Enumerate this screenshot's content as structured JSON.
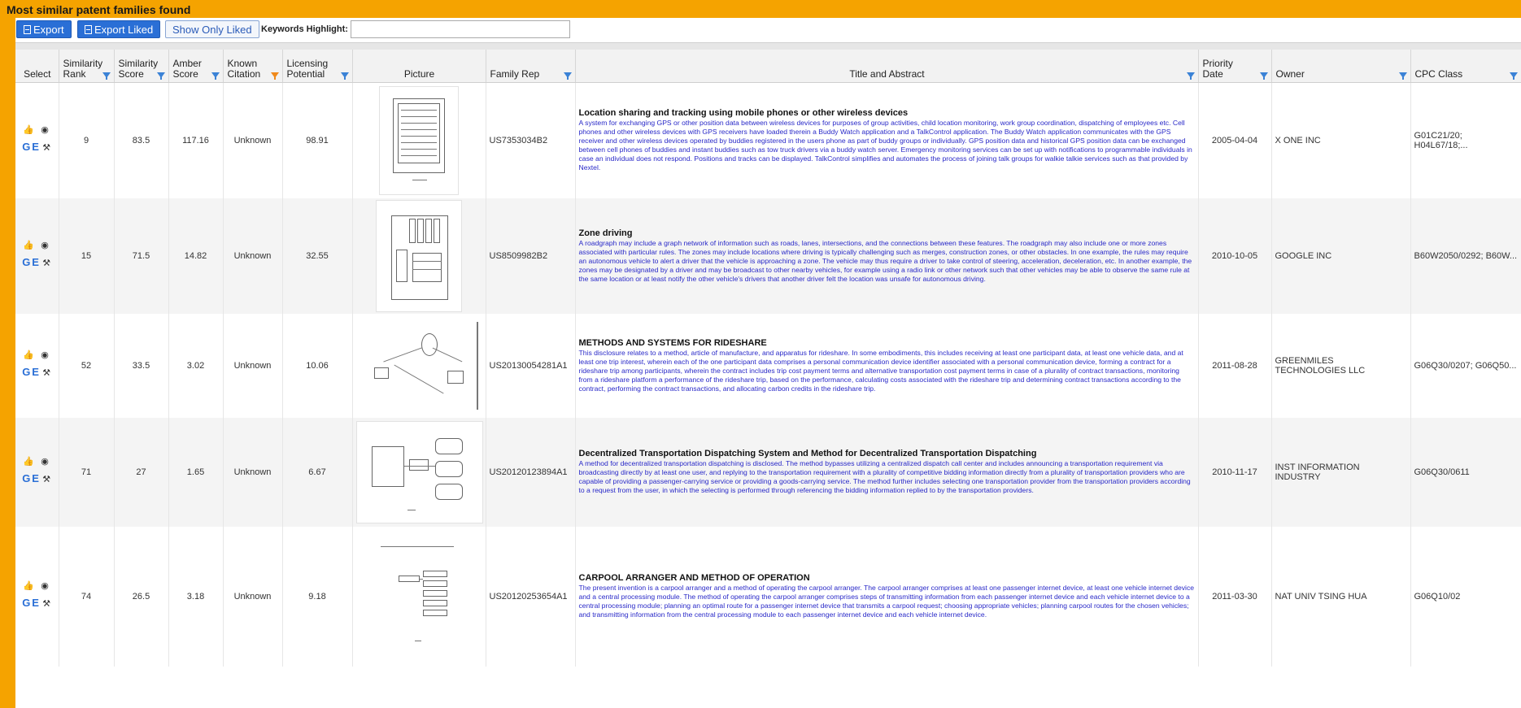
{
  "header": {
    "title": "Most similar patent families found"
  },
  "toolbar": {
    "export_label": "Export",
    "export_liked_label": "Export Liked",
    "show_liked_label": "Show Only Liked",
    "keywords_label": "Keywords Highlight:",
    "keywords_value": ""
  },
  "columns": {
    "select": "Select",
    "similarity_rank": [
      "Similarity",
      "Rank"
    ],
    "similarity_score": [
      "Similarity",
      "Score"
    ],
    "amber_score": [
      "Amber",
      "Score"
    ],
    "known_citation": [
      "Known",
      "Citation"
    ],
    "licensing_potential": [
      "Licensing",
      "Potential"
    ],
    "picture": "Picture",
    "family_rep": "Family Rep",
    "title_abstract": "Title and Abstract",
    "priority_date": [
      "Priority",
      "Date"
    ],
    "owner": "Owner",
    "cpc_class": "CPC Class"
  },
  "icons": {
    "like": "thumbs-up-icon",
    "hide": "eye-slash-icon",
    "google": "G",
    "espacenet": "E",
    "tools": "tools-icon"
  },
  "colors": {
    "accent": "#f5a300",
    "button": "#2a6fd6",
    "abstract_text": "#2929c8",
    "filter_icon": "#3b82d6",
    "filter_active": "#f08a1c"
  },
  "rows": [
    {
      "rank": "9",
      "sim_score": "83.5",
      "amber": "117.16",
      "citation": "Unknown",
      "licensing": "98.91",
      "family_rep": "US7353034B2",
      "title": "Location sharing and tracking using mobile phones or other wireless devices",
      "abstract": "A system for exchanging GPS or other position data between wireless devices for purposes of group activities, child location monitoring, work group coordination, dispatching of employees etc. Cell phones and other wireless devices with GPS receivers have loaded therein a Buddy Watch application and a TalkControl application. The Buddy Watch application communicates with the GPS receiver and other wireless devices operated by buddies registered in the users phone as part of buddy groups or individually. GPS position data and historical GPS position data can be exchanged between cell phones of buddies and instant buddies such as tow truck drivers via a buddy watch server. Emergency monitoring services can be set up with notifications to programmable individuals in case an individual does not respond. Positions and tracks can be displayed. TalkControl simplifies and automates the process of joining talk groups for walkie talkie services such as that provided by Nextel.",
      "priority_date": "2005-04-04",
      "owner": "X ONE INC",
      "cpc": "G01C21/20; H04L67/18;..."
    },
    {
      "rank": "15",
      "sim_score": "71.5",
      "amber": "14.82",
      "citation": "Unknown",
      "licensing": "32.55",
      "family_rep": "US8509982B2",
      "title": "Zone driving",
      "abstract": "A roadgraph may include a graph network of information such as roads, lanes, intersections, and the connections between these features. The roadgraph may also include one or more zones associated with particular rules. The zones may include locations where driving is typically challenging such as merges, construction zones, or other obstacles. In one example, the rules may require an autonomous vehicle to alert a driver that the vehicle is approaching a zone. The vehicle may thus require a driver to take control of steering, acceleration, deceleration, etc. In another example, the zones may be designated by a driver and may be broadcast to other nearby vehicles, for example using a radio link or other network such that other vehicles may be able to observe the same rule at the same location or at least notify the other vehicle's drivers that another driver felt the location was unsafe for autonomous driving.",
      "priority_date": "2010-10-05",
      "owner": "GOOGLE INC",
      "cpc": "B60W2050/0292; B60W..."
    },
    {
      "rank": "52",
      "sim_score": "33.5",
      "amber": "3.02",
      "citation": "Unknown",
      "licensing": "10.06",
      "family_rep": "US20130054281A1",
      "title": "METHODS AND SYSTEMS FOR RIDESHARE",
      "abstract": "This disclosure relates to a method, article of manufacture, and apparatus for rideshare. In some embodiments, this includes receiving at least one participant data, at least one vehicle data, and at least one trip interest, wherein each of the one participant data comprises a personal communication device identifier associated with a personal communication device, forming a contract for a rideshare trip among participants, wherein the contract includes trip cost payment terms and alternative transportation cost payment terms in case of a plurality of contract transactions, monitoring from a rideshare platform a performance of the rideshare trip, based on the performance, calculating costs associated with the rideshare trip and determining contract transactions according to the contract, performing the contract transactions, and allocating carbon credits in the rideshare trip.",
      "priority_date": "2011-08-28",
      "owner": "GREENMILES TECHNOLOGIES LLC",
      "cpc": "G06Q30/0207; G06Q50..."
    },
    {
      "rank": "71",
      "sim_score": "27",
      "amber": "1.65",
      "citation": "Unknown",
      "licensing": "6.67",
      "family_rep": "US20120123894A1",
      "title": "Decentralized Transportation Dispatching System and Method for Decentralized Transportation Dispatching",
      "abstract": "A method for decentralized transportation dispatching is disclosed. The method bypasses utilizing a centralized dispatch call center and includes announcing a transportation requirement via broadcasting directly by at least one user, and replying to the transportation requirement with a plurality of competitive bidding information directly from a plurality of transportation providers who are capable of providing a passenger-carrying service or providing a goods-carrying service. The method further includes selecting one transportation provider from the transportation providers according to a request from the user, in which the selecting is performed through referencing the bidding information replied to by the transportation providers.",
      "priority_date": "2010-11-17",
      "owner": "INST INFORMATION INDUSTRY",
      "cpc": "G06Q30/0611"
    },
    {
      "rank": "74",
      "sim_score": "26.5",
      "amber": "3.18",
      "citation": "Unknown",
      "licensing": "9.18",
      "family_rep": "US20120253654A1",
      "title": "CARPOOL ARRANGER AND METHOD OF OPERATION",
      "abstract": "The present invention is a carpool arranger and a method of operating the carpool arranger. The carpool arranger comprises at least one passenger internet device, at least one vehicle internet device and a central processing module. The method of operating the carpool arranger comprises steps of transmitting information from each passenger internet device and each vehicle internet device to a central processing module; planning an optimal route for a passenger internet device that transmits a carpool request; choosing appropriate vehicles; planning carpool routes for the chosen vehicles; and transmitting information from the central processing module to each passenger internet device and each vehicle internet device.",
      "priority_date": "2011-03-30",
      "owner": "NAT UNIV TSING HUA",
      "cpc": "G06Q10/02"
    }
  ]
}
